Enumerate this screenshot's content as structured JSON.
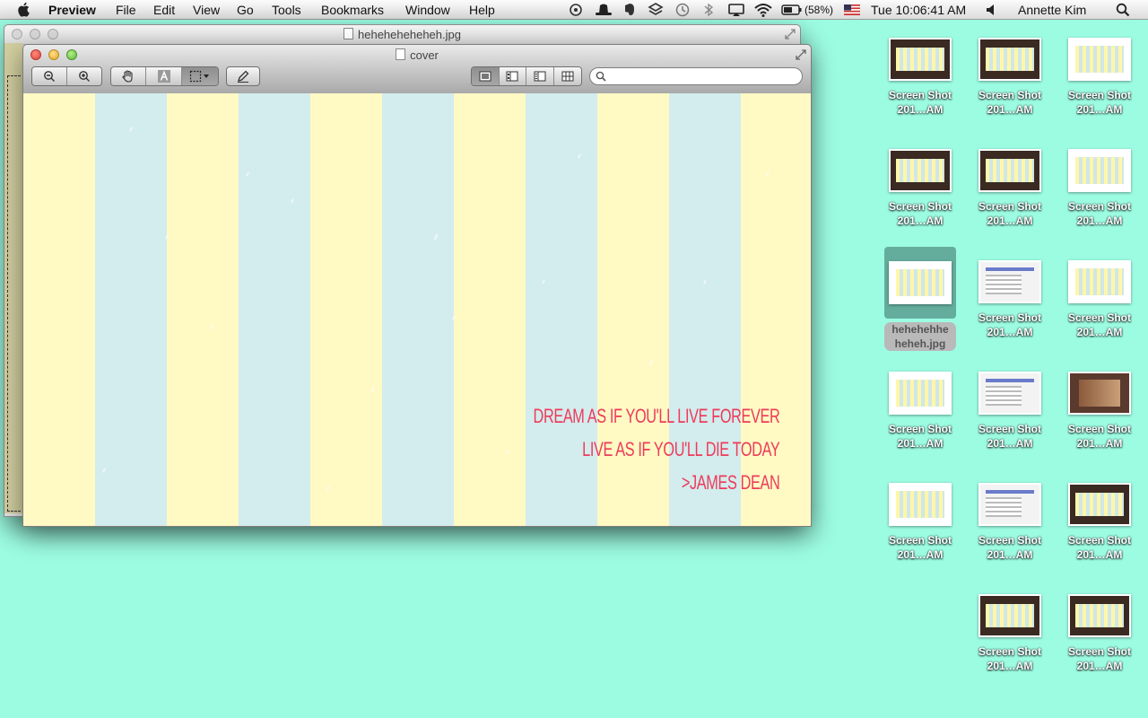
{
  "menubar": {
    "app_name": "Preview",
    "menus": [
      "File",
      "Edit",
      "View",
      "Go",
      "Tools",
      "Bookmarks",
      "Window",
      "Help"
    ],
    "battery": "(58%)",
    "clock": "Tue 10:06:41 AM",
    "user": "Annette Kim"
  },
  "back_window": {
    "title": "heheheheheheh.jpg"
  },
  "front_window": {
    "title": "cover",
    "search": {
      "value": "",
      "placeholder": ""
    },
    "image": {
      "quote_lines": [
        "DREAM AS IF YOU'LL LIVE FOREVER",
        "LIVE AS IF YOU'LL DIE TODAY",
        ">JAMES DEAN"
      ],
      "colors": {
        "stripe_yellow": "#fff9c4",
        "stripe_blue": "#d3ecee",
        "text": "#ee3b59"
      }
    }
  },
  "desktop": {
    "background": "#9cfce2",
    "icons": [
      {
        "label1": "Screen Shot",
        "label2": "201…AM",
        "style": "dark"
      },
      {
        "label1": "Screen Shot",
        "label2": "201…AM",
        "style": "dark"
      },
      {
        "label1": "Screen Shot",
        "label2": "201…AM",
        "style": "plain"
      },
      {
        "label1": "Screen Shot",
        "label2": "201…AM",
        "style": "dark"
      },
      {
        "label1": "Screen Shot",
        "label2": "201…AM",
        "style": "dark"
      },
      {
        "label1": "Screen Shot",
        "label2": "201…AM",
        "style": "plain"
      },
      {
        "label1": "hehehehhe",
        "label2": "heheh.jpg",
        "style": "plain",
        "selected": true
      },
      {
        "label1": "Screen Shot",
        "label2": "201…AM",
        "style": "web"
      },
      {
        "label1": "Screen Shot",
        "label2": "201…AM",
        "style": "plain"
      },
      {
        "label1": "Screen Shot",
        "label2": "201…AM",
        "style": "plain"
      },
      {
        "label1": "Screen Shot",
        "label2": "201…AM",
        "style": "web"
      },
      {
        "label1": "Screen Shot",
        "label2": "201…AM",
        "style": "photo"
      },
      {
        "label1": "Screen Shot",
        "label2": "201…AM",
        "style": "plain"
      },
      {
        "label1": "Screen Shot",
        "label2": "201…AM",
        "style": "web"
      },
      {
        "label1": "Screen Shot",
        "label2": "201…AM",
        "style": "dark"
      },
      {
        "label1": "Screen Shot",
        "label2": "201…AM",
        "style": "dark"
      },
      {
        "label1": "Screen Shot",
        "label2": "201…AM",
        "style": "dark"
      }
    ]
  }
}
